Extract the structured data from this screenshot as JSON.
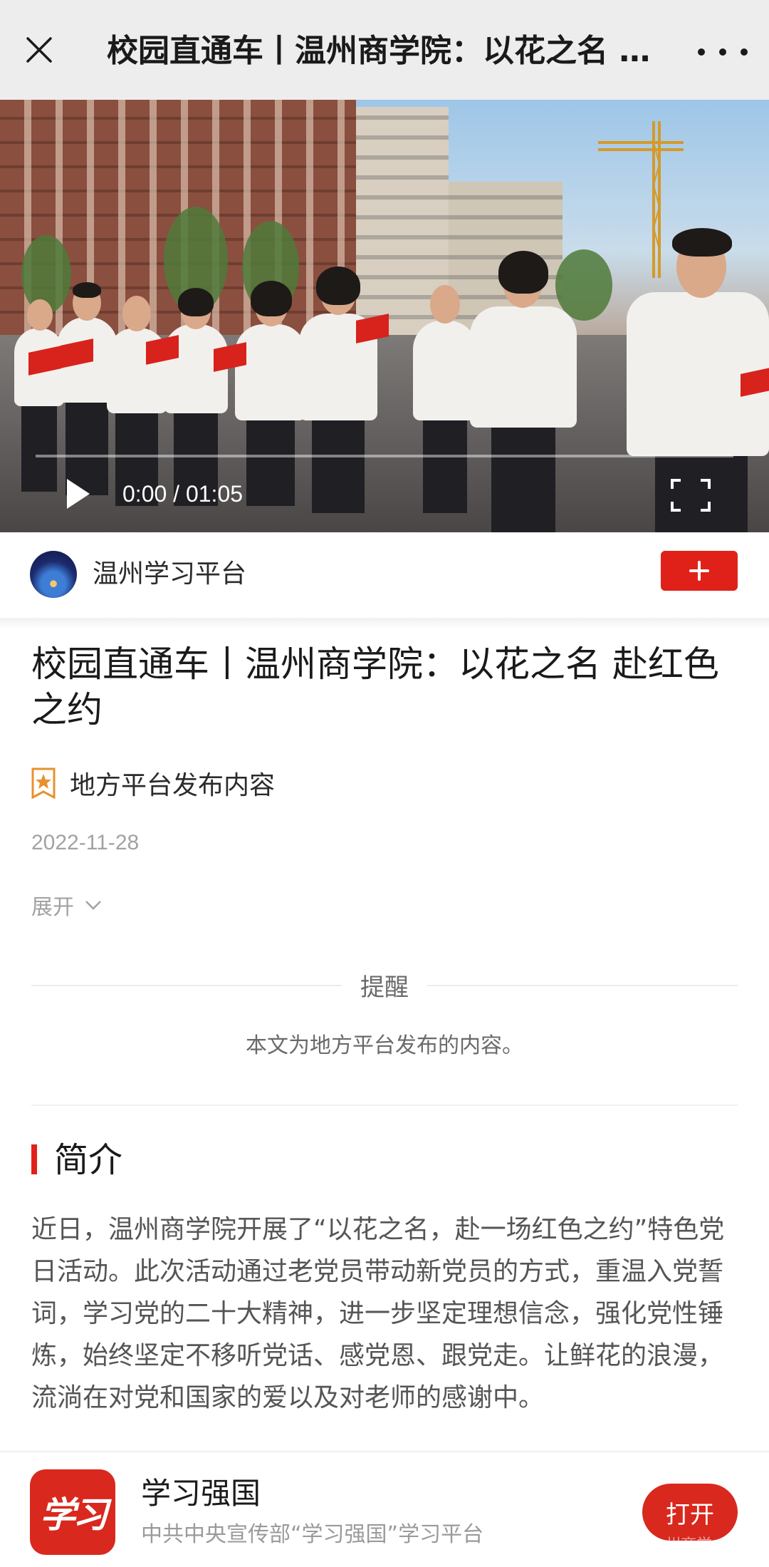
{
  "topbar": {
    "title": "校园直通车丨温州商学院：以花之名 赴红色之约",
    "close_icon": "close-icon",
    "more_icon": "more-icon"
  },
  "video": {
    "time": "0:00 / 01:05",
    "progress": 0,
    "play_icon": "play-icon",
    "fullscreen_icon": "fullscreen-icon"
  },
  "channel": {
    "name": "温州学习平台",
    "follow_icon": "plus-icon"
  },
  "article": {
    "title": "校园直通车丨温州商学院：以花之名 赴红色之约",
    "badge_text": "地方平台发布内容",
    "date": "2022-11-28",
    "expand_label": "展开"
  },
  "reminder": {
    "title": "提醒",
    "text": "本文为地方平台发布的内容。"
  },
  "intro": {
    "heading": "简介",
    "body": "近日，温州商学院开展了“以花之名，赴一场红色之约”特色党日活动。此次活动通过老党员带动新党员的方式，重温入党誓词，学习党的二十大精神，进一步坚定理想信念，强化党性锤炼，始终坚定不移听党话、感党恩、跟党走。让鲜花的浪漫，流淌在对党和国家的爱以及对老师的感谢中。"
  },
  "banner": {
    "logo_text": "学习",
    "app_name": "学习强国",
    "app_desc": "中共中央宣传部“学习强国”学习平台",
    "open_label": "打开",
    "watermark": "州商学"
  },
  "colors": {
    "accent_red": "#e0211a",
    "topbar_bg": "#ededed",
    "muted_text": "#a2a2a2"
  }
}
